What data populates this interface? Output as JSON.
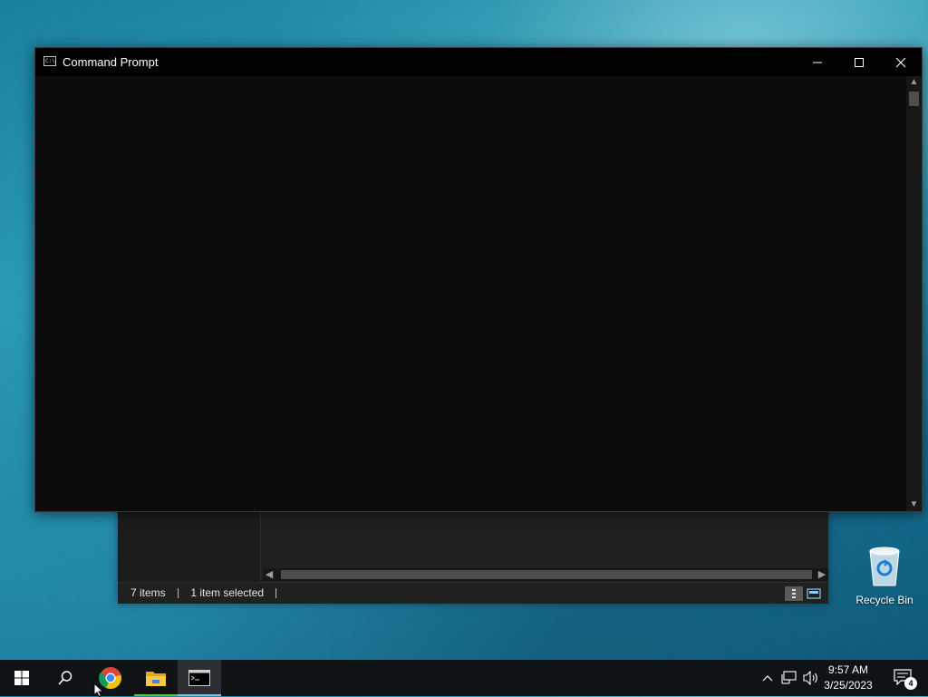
{
  "cmd": {
    "title": "Command Prompt",
    "icon_label": "C:\\",
    "min_glyph": "—",
    "max_glyph": "☐",
    "close_glyph": "✕",
    "scroll_up": "▲",
    "scroll_down": "▼"
  },
  "explorer": {
    "status_items": "7 items",
    "status_selected": "1 item selected",
    "scroll_left": "◀",
    "scroll_right": "▶"
  },
  "desktop": {
    "recycle_bin_label": "Recycle Bin"
  },
  "taskbar": {
    "apps": [
      "start-icon",
      "search-icon",
      "chrome-icon",
      "file-explorer-icon",
      "command-prompt-icon"
    ],
    "time": "9:57 AM",
    "date": "3/25/2023",
    "notification_count": "4"
  },
  "colors": {
    "accent": "#7cc0e8",
    "titlebar": "#000000",
    "console_bg": "#0c0c0c",
    "taskbar_bg": "#101316"
  }
}
